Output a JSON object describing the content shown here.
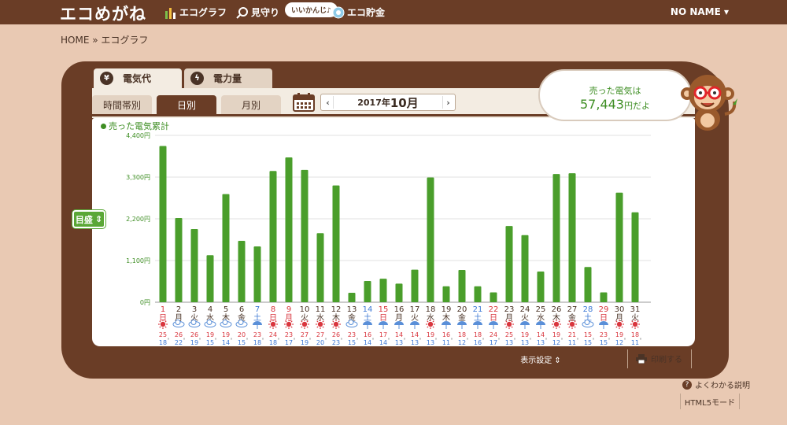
{
  "header": {
    "logo": "エコめがね",
    "nav": [
      {
        "label": "エコグラフ",
        "icon": "bar-chart-icon"
      },
      {
        "label": "見守り",
        "icon": "watch-icon"
      },
      {
        "label": "エコ貯金",
        "icon": "coin-icon"
      }
    ],
    "bubble": "いいかんじ♪",
    "user": "NO NAME ▾"
  },
  "breadcrumb": "HOME » エコグラフ",
  "main_tabs": [
    {
      "label": "電気代",
      "icon_char": "¥"
    },
    {
      "label": "電力量",
      "icon_char": "ϟ"
    }
  ],
  "sub_tabs": [
    "時間帯別",
    "日別",
    "月別"
  ],
  "month_nav": {
    "year": "2017年",
    "month": "10月",
    "prev": "‹",
    "next": "›"
  },
  "sold": {
    "line1": "売った電気は",
    "amount": "57,443",
    "unit": "円だよ"
  },
  "side_button": {
    "label": "目盛",
    "caret": "⇕"
  },
  "footer": {
    "settings": "表示設定 ⇕",
    "print": "印刷する",
    "help": "よくわかる説明",
    "help_q": "?",
    "html5": "HTML5モード"
  },
  "chart_data": {
    "type": "bar",
    "series_label": "売った電気累計",
    "ylim": [
      0,
      4400
    ],
    "yticks": [
      "0円",
      "1,100円",
      "2,200円",
      "3,300円",
      "4,400円"
    ],
    "ytick_values": [
      0,
      1100,
      2200,
      3300,
      4400
    ],
    "days": [
      "1",
      "2",
      "3",
      "4",
      "5",
      "6",
      "7",
      "8",
      "9",
      "10",
      "11",
      "12",
      "13",
      "14",
      "15",
      "16",
      "17",
      "18",
      "19",
      "20",
      "21",
      "22",
      "23",
      "24",
      "25",
      "26",
      "27",
      "28",
      "29",
      "30",
      "31"
    ],
    "weekdays": [
      "日",
      "月",
      "火",
      "水",
      "木",
      "金",
      "土",
      "日",
      "月",
      "火",
      "水",
      "木",
      "金",
      "土",
      "日",
      "月",
      "火",
      "水",
      "木",
      "金",
      "土",
      "日",
      "月",
      "火",
      "水",
      "木",
      "金",
      "土",
      "日",
      "月",
      "火"
    ],
    "day_colors": [
      "red",
      "dark",
      "dark",
      "dark",
      "dark",
      "dark",
      "blue",
      "red",
      "red",
      "dark",
      "dark",
      "dark",
      "dark",
      "blue",
      "red",
      "dark",
      "dark",
      "dark",
      "dark",
      "dark",
      "blue",
      "red",
      "dark",
      "dark",
      "dark",
      "dark",
      "dark",
      "blue",
      "red",
      "dark",
      "dark"
    ],
    "values": [
      4120,
      2220,
      1930,
      1240,
      2850,
      1620,
      1470,
      3460,
      3820,
      3490,
      1820,
      3080,
      250,
      560,
      620,
      490,
      860,
      3290,
      420,
      850,
      420,
      260,
      2010,
      1770,
      810,
      3380,
      3400,
      930,
      260,
      2890,
      2370
    ],
    "weather": [
      "sun",
      "cloud",
      "cloud",
      "cloud",
      "cloud",
      "cloud",
      "rain",
      "sun",
      "sun",
      "sun",
      "sun",
      "sun",
      "cloud",
      "rain",
      "rain",
      "rain",
      "rain",
      "sun",
      "rain",
      "rain",
      "rain",
      "rain",
      "sun",
      "rain",
      "rain",
      "sun",
      "sun",
      "cloud",
      "rain",
      "sun",
      "sun"
    ],
    "temp_high": [
      25,
      26,
      26,
      19,
      19,
      20,
      23,
      24,
      23,
      27,
      27,
      26,
      23,
      16,
      17,
      14,
      14,
      19,
      16,
      18,
      18,
      24,
      25,
      19,
      14,
      19,
      21,
      15,
      23,
      19,
      18
    ],
    "temp_low": [
      18,
      22,
      19,
      15,
      14,
      15,
      18,
      18,
      17,
      19,
      20,
      23,
      15,
      14,
      14,
      13,
      13,
      13,
      11,
      12,
      16,
      17,
      13,
      13,
      13,
      12,
      11,
      15,
      15,
      12,
      11
    ],
    "temp_unit": "°",
    "colors": {
      "bar": "#4a9e2b",
      "red": "#d9363e",
      "blue": "#3f7ad6",
      "dark": "#4a3326"
    }
  }
}
